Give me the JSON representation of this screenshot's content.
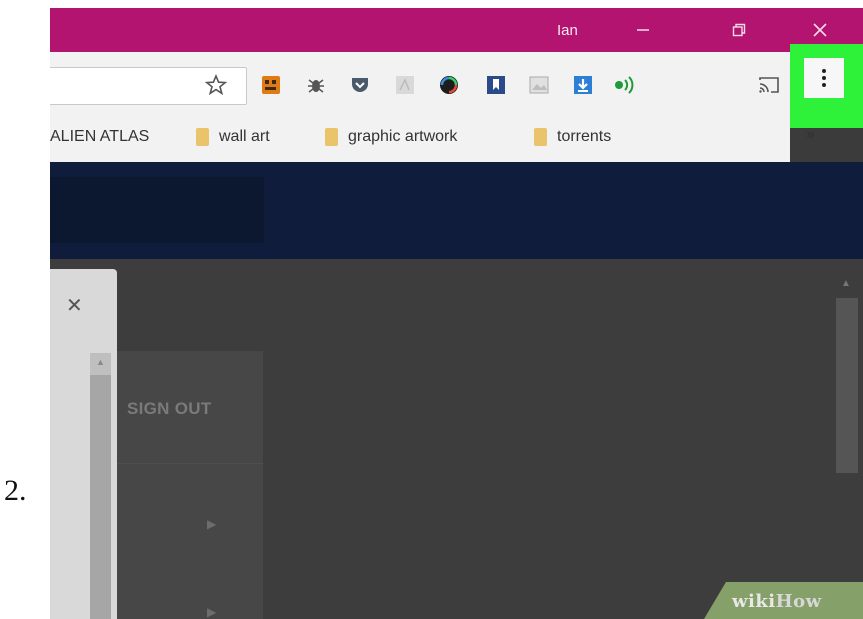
{
  "step": {
    "number": "2."
  },
  "titlebar": {
    "user_name": "Ian",
    "minimize_icon": "minimize-icon",
    "restore_icon": "restore-icon",
    "close_icon": "close-icon",
    "color": "#b3146f"
  },
  "toolbar": {
    "bookmark_star_icon": "star-icon",
    "extensions": [
      "extension-orange-icon",
      "extension-bug-icon",
      "pocket-icon",
      "pdf-icon",
      "color-wheel-icon",
      "bookmark-extension-icon",
      "image-icon",
      "download-icon",
      "audio-icon",
      "cast-icon"
    ],
    "menu_icon": "vertical-dots-icon",
    "highlight_color": "#2ef23a"
  },
  "bookmarks": {
    "items": [
      {
        "label": "ALIEN ATLAS",
        "folder": false
      },
      {
        "label": "wall art",
        "folder": true
      },
      {
        "label": "graphic artwork",
        "folder": true
      },
      {
        "label": "torrents",
        "folder": true
      }
    ],
    "overflow": "»"
  },
  "site": {
    "header_color": "#0f1c3c",
    "panel": {
      "close_glyph": "✕"
    },
    "menu": {
      "sign_out": "SIGN OUT"
    }
  },
  "watermark": {
    "wiki": "wiki",
    "how": "How"
  }
}
